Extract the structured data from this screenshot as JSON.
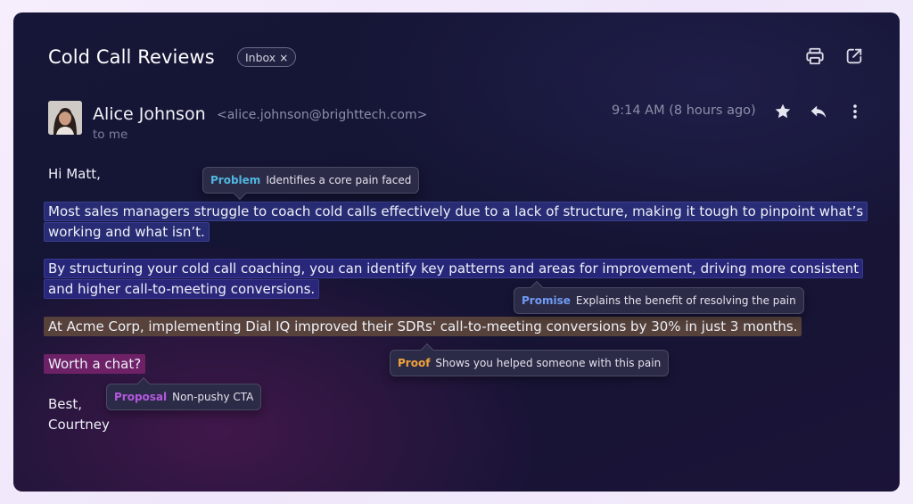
{
  "email": {
    "subject": "Cold Call Reviews",
    "label_chip": "Inbox",
    "label_chip_close": "×",
    "sender_name": "Alice Johnson",
    "sender_email": "<alice.johnson@brighttech.com>",
    "recipient": "to me",
    "time": "9:14 AM  (8 hours ago)",
    "greeting": "Hi Matt,",
    "paragraphs": {
      "problem": "Most sales managers struggle to coach cold calls effectively due to a lack of structure, making it tough to pinpoint what’s working and what isn’t.",
      "promise": "By structuring your cold call coaching, you can identify key patterns and areas for improvement, driving more consistent and higher call-to-meeting conversions.",
      "proof": "At Acme Corp, implementing Dial IQ improved their SDRs' call-to-meeting conversions by 30% in just 3 months.",
      "proposal": "Worth a chat?"
    },
    "signoff": "Best,",
    "signature": "Courtney"
  },
  "annotations": {
    "problem": {
      "label": "Problem",
      "text": "Identifies a core pain faced",
      "color": "#4fb7e0"
    },
    "promise": {
      "label": "Promise",
      "text": "Explains the benefit of resolving the pain",
      "color": "#6f9bf5"
    },
    "proof": {
      "label": "Proof",
      "text": "Shows you helped someone with this pain",
      "color": "#f0a33a"
    },
    "proposal": {
      "label": "Proposal",
      "text": "Non-pushy CTA",
      "color": "#b458e0"
    }
  },
  "icons": [
    "print-icon",
    "open-in-new-window-icon",
    "star-icon",
    "reply-icon",
    "more-vertical-icon"
  ],
  "colors": {
    "background": "#151535",
    "problem_highlight": "#373fa8",
    "promise_highlight": "#3434a8",
    "proof_highlight": "#624a3c",
    "proposal_highlight": "#7a236e"
  }
}
